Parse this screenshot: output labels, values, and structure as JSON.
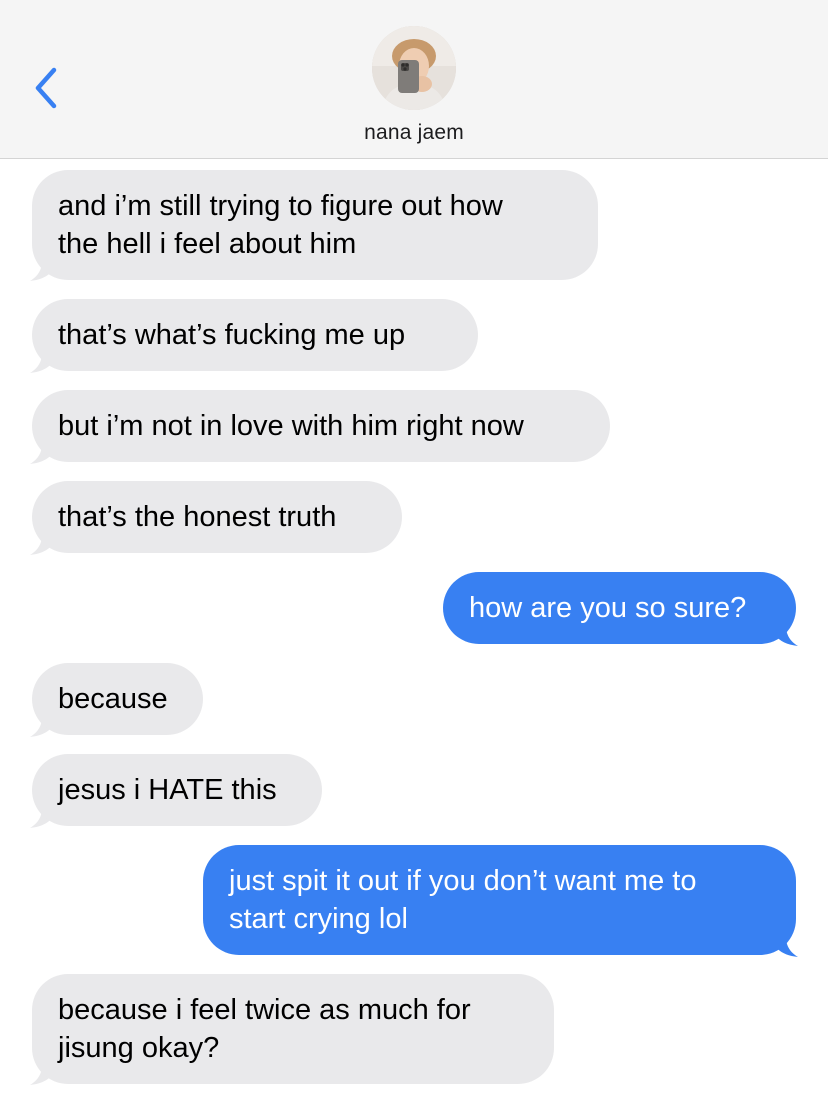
{
  "header": {
    "contact_name": "nana jaem"
  },
  "colors": {
    "incoming_bubble": "#e9e9eb",
    "outgoing_bubble": "#3880f2",
    "back_chevron": "#3880f2",
    "header_background": "#f5f5f5"
  },
  "icons": {
    "back": "chevron-left-icon",
    "avatar": "contact-photo"
  },
  "messages": [
    {
      "direction": "incoming",
      "text": "and i’m still trying to figure out how\nthe hell i feel about him"
    },
    {
      "direction": "incoming",
      "text": "that’s what’s fucking me up"
    },
    {
      "direction": "incoming",
      "text": "but i’m not in love with him right now"
    },
    {
      "direction": "incoming",
      "text": "that’s the honest truth"
    },
    {
      "direction": "outgoing",
      "text": "how are you so sure?"
    },
    {
      "direction": "incoming",
      "text": "because"
    },
    {
      "direction": "incoming",
      "text": "jesus i HATE this"
    },
    {
      "direction": "outgoing",
      "text": "just spit it out if you don’t want me to\nstart crying lol"
    },
    {
      "direction": "incoming",
      "text": "because i feel twice as much for\njisung okay?"
    }
  ]
}
